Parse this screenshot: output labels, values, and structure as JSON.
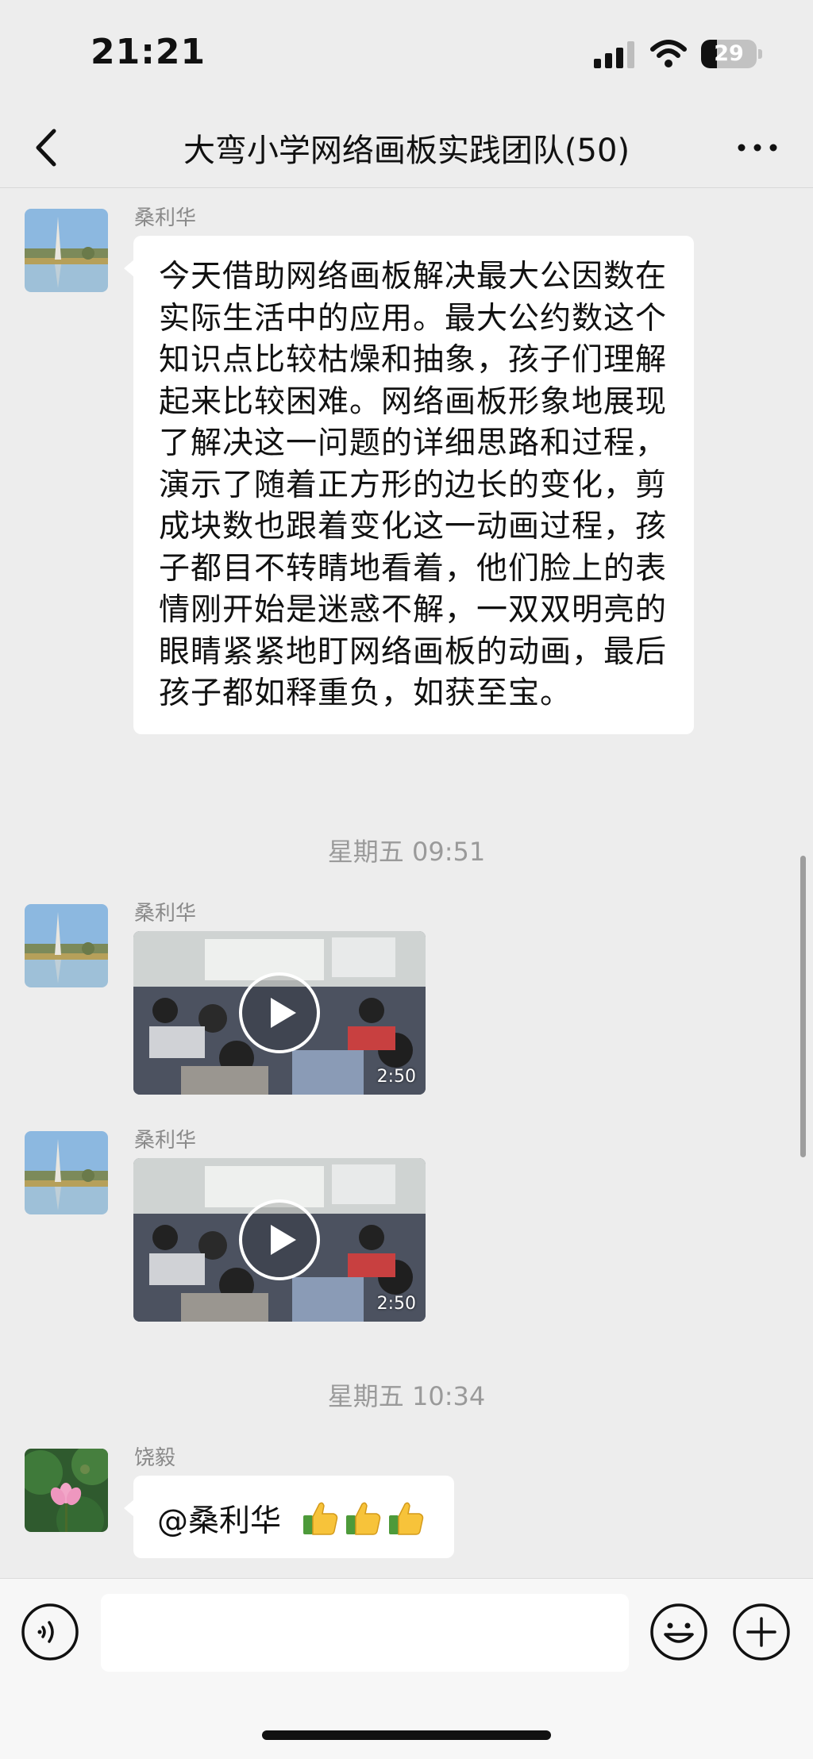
{
  "status_bar": {
    "time": "21:21",
    "battery_level": "29",
    "icons": [
      "cellular-signal-icon",
      "wifi-icon",
      "battery-icon"
    ]
  },
  "nav": {
    "title": "大弯小学网络画板实践团队(50)",
    "back_icon": "chevron-left-icon",
    "more_icon": "ellipsis-icon"
  },
  "messages": [
    {
      "type": "text",
      "sender": "桑利华",
      "avatar": "tower-lake-avatar",
      "text": "今天借助网络画板解决最大公因数在实际生活中的应用。最大公约数这个知识点比较枯燥和抽象，孩子们理解起来比较困难。网络画板形象地展现了解决这一问题的详细思路和过程，演示了随着正方形的边长的变化，剪成块数也跟着变化这一动画过程，孩子都目不转睛地看着，他们脸上的表情刚开始是迷惑不解，一双双明亮的眼睛紧紧地盯网络画板的动画，最后孩子都如释重负，如获至宝。"
    },
    {
      "type": "timestamp",
      "text": "星期五 09:51"
    },
    {
      "type": "video",
      "sender": "桑利华",
      "avatar": "tower-lake-avatar",
      "duration": "2:50"
    },
    {
      "type": "video",
      "sender": "桑利华",
      "avatar": "tower-lake-avatar",
      "duration": "2:50"
    },
    {
      "type": "timestamp",
      "text": "星期五 10:34"
    },
    {
      "type": "text",
      "sender": "饶毅",
      "avatar": "lotus-avatar",
      "text": "@桑利华",
      "emoji": "thumbs-up x3"
    }
  ],
  "input_bar": {
    "placeholder": "",
    "voice_icon": "voice-icon",
    "emoji_icon": "emoji-icon",
    "plus_icon": "plus-icon"
  },
  "colors": {
    "background": "#ededed",
    "bubble": "#ffffff",
    "meta_text": "#9a9a9a"
  }
}
